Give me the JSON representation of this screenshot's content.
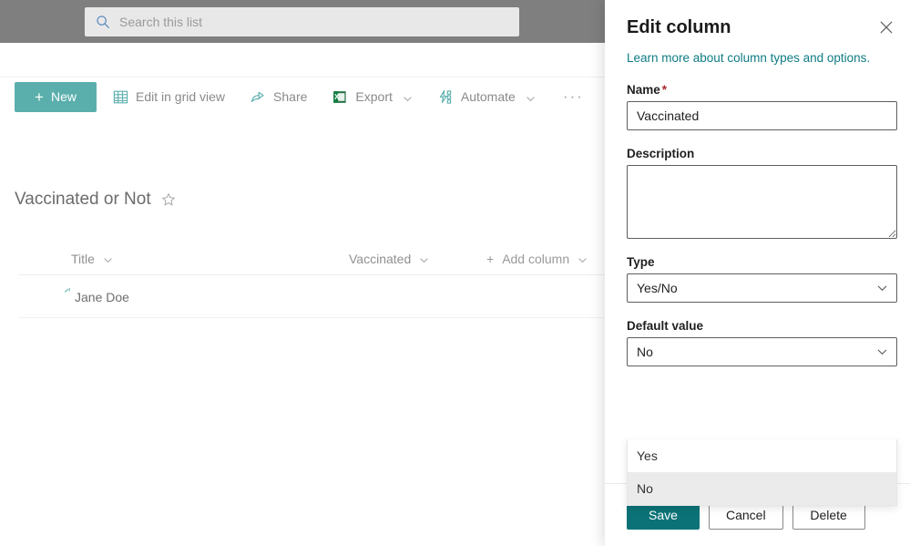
{
  "suite": {
    "search": {
      "placeholder": "Search this list",
      "value": "",
      "icon": "search-icon"
    }
  },
  "commandbar": {
    "new_label": "New",
    "new_plus": "+",
    "items": [
      {
        "label": "Edit in grid view",
        "icon": "grid-icon",
        "has_chevron": false
      },
      {
        "label": "Share",
        "icon": "share-icon",
        "has_chevron": false
      },
      {
        "label": "Export",
        "icon": "excel-icon",
        "has_chevron": true
      },
      {
        "label": "Automate",
        "icon": "automate-icon",
        "has_chevron": true
      }
    ],
    "overflow_label": "···"
  },
  "list": {
    "title": "Vaccinated or Not",
    "favorite_icon": "star-icon",
    "columns": [
      {
        "label": "Title",
        "has_chevron": true
      },
      {
        "label": "Vaccinated",
        "has_chevron": true
      },
      {
        "label": "Add column",
        "has_chevron": true,
        "plus": "+"
      }
    ],
    "rows": [
      {
        "title": "Jane Doe",
        "vaccinated": "",
        "badge_icon": "new-item-sparkle-icon"
      }
    ]
  },
  "panel": {
    "title": "Edit column",
    "close_icon": "close-icon",
    "learn_more_link": "Learn more about column types and options.",
    "fields": {
      "name": {
        "label": "Name",
        "required_marker": "*",
        "value": "Vaccinated",
        "placeholder": ""
      },
      "description": {
        "label": "Description",
        "value": "",
        "placeholder": ""
      },
      "type": {
        "label": "Type",
        "value": "Yes/No",
        "chevron_icon": "chevron-down-icon"
      },
      "default_value": {
        "label": "Default value",
        "value": "No",
        "chevron_icon": "chevron-down-icon",
        "expanded": true,
        "options": [
          {
            "label": "Yes",
            "selected": false
          },
          {
            "label": "No",
            "selected": true
          }
        ]
      }
    },
    "footer": {
      "save_label": "Save",
      "cancel_label": "Cancel",
      "delete_label": "Delete"
    }
  },
  "colors": {
    "accent_teal": "#0b7377",
    "command_teal": "#5aafad",
    "link_teal": "#0f7c84",
    "required_red": "#a4262c",
    "suite_bar_gray": "#7f7f7f",
    "dropdown_selected_gray": "#ebebeb"
  }
}
